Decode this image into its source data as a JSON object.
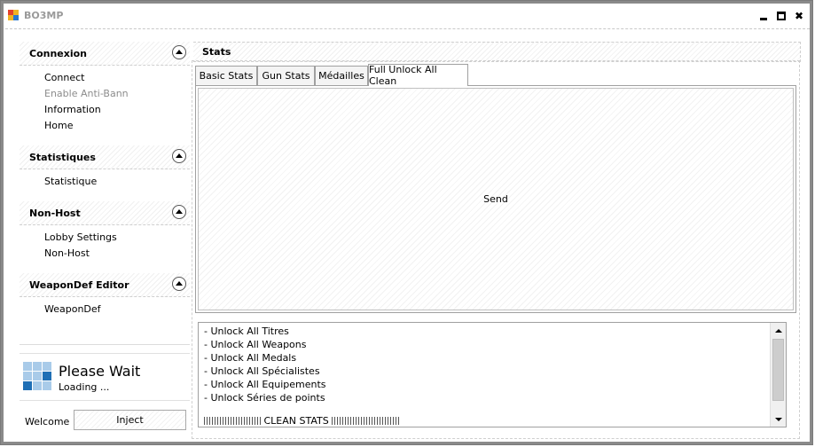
{
  "window": {
    "title": "BO3MP",
    "icon": "app-windows-icon",
    "controls": {
      "minimize": "minimize-icon",
      "maximize": "maximize-icon",
      "close_glyph": "✖"
    }
  },
  "sidebar": {
    "sections": [
      {
        "title": "Connexion",
        "items": [
          {
            "label": "Connect",
            "enabled": true
          },
          {
            "label": "Enable Anti-Bann",
            "enabled": false
          },
          {
            "label": "Information",
            "enabled": true
          },
          {
            "label": "Home",
            "enabled": true
          }
        ]
      },
      {
        "title": "Statistiques",
        "items": [
          {
            "label": "Statistique",
            "enabled": true
          }
        ]
      },
      {
        "title": "Non-Host",
        "items": [
          {
            "label": "Lobby Settings",
            "enabled": true
          },
          {
            "label": "Non-Host",
            "enabled": true
          }
        ]
      },
      {
        "title": "WeaponDef Editor",
        "items": [
          {
            "label": "WeaponDef",
            "enabled": true
          }
        ]
      }
    ],
    "loading": {
      "title": "Please Wait",
      "status": "Loading ..."
    },
    "welcome_label": "Welcome :",
    "inject_label": "Inject"
  },
  "main": {
    "header": "Stats",
    "tabs": [
      {
        "label": "Basic Stats",
        "active": false
      },
      {
        "label": "Gun Stats",
        "active": false
      },
      {
        "label": "Médailles",
        "active": false
      },
      {
        "label": "Full Unlock All Clean",
        "active": true
      }
    ],
    "send_label": "Send",
    "list_items": [
      "- Unlock All Titres",
      "- Unlock All Weapons",
      "- Unlock All Medals",
      "- Unlock All Spécialistes",
      "- Unlock All Equipements",
      "- Unlock Séries de points"
    ],
    "clean_label": "CLEAN STATS"
  },
  "colors": {
    "frame": "#8a8a8a",
    "disabled_text": "#8c8c8c",
    "icon_blue_dark": "#1f6fb5",
    "icon_blue_light": "#a9cbe9"
  }
}
